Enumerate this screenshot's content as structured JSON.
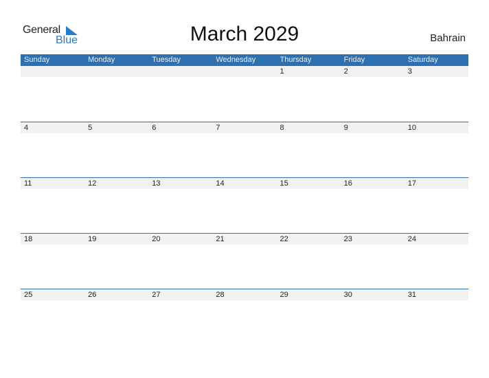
{
  "logo": {
    "word1": "General",
    "word2": "Blue"
  },
  "title": "March 2029",
  "country": "Bahrain",
  "weekdays": [
    "Sunday",
    "Monday",
    "Tuesday",
    "Wednesday",
    "Thursday",
    "Friday",
    "Saturday"
  ],
  "weeks": [
    [
      "",
      "",
      "",
      "",
      "1",
      "2",
      "3"
    ],
    [
      "4",
      "5",
      "6",
      "7",
      "8",
      "9",
      "10"
    ],
    [
      "11",
      "12",
      "13",
      "14",
      "15",
      "16",
      "17"
    ],
    [
      "18",
      "19",
      "20",
      "21",
      "22",
      "23",
      "24"
    ],
    [
      "25",
      "26",
      "27",
      "28",
      "29",
      "30",
      "31"
    ]
  ],
  "colors": {
    "accent": "#2e6fb0",
    "logo_blue": "#2a7ac0",
    "strip": "#f2f2f2"
  }
}
